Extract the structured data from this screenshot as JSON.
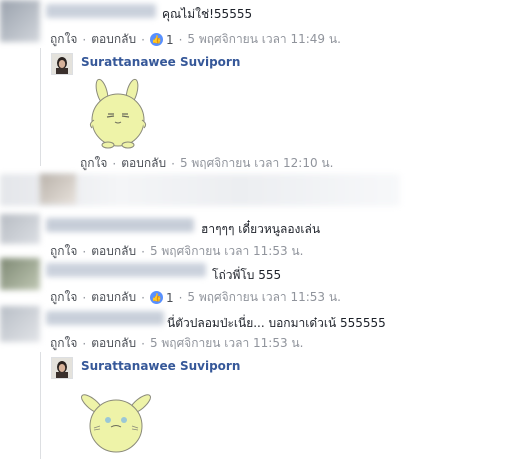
{
  "comments": [
    {
      "text": "คุณไม่ใช่!55555",
      "like": "ถูกใจ",
      "reply": "ตอบกลับ",
      "likes": "1",
      "time": "5 พฤศจิกายน เวลา 11:49 น."
    },
    {
      "text": "ฮาๆๆๆ เดี๋ยวหนูลองเล่น",
      "like": "ถูกใจ",
      "reply": "ตอบกลับ",
      "time": "5 พฤศจิกายน เวลา 11:53 น."
    },
    {
      "text": "โถ่วพี่โบ 555",
      "like": "ถูกใจ",
      "reply": "ตอบกลับ",
      "likes": "1",
      "time": "5 พฤศจิกายน เวลา 11:53 น."
    },
    {
      "text": "นี่ตัวปลอมป่ะเนี่ย... บอกมาเด๋วเน้ 555555",
      "like": "ถูกใจ",
      "reply": "ตอบกลับ",
      "time": "5 พฤศจิกายน เวลา 11:53 น."
    }
  ],
  "replies": [
    {
      "author": "Surattanawee Suviporn",
      "like": "ถูกใจ",
      "reply": "ตอบกลับ",
      "time": "5 พฤศจิกายน เวลา 12:10 น.",
      "sticker": "bunny-sticker"
    },
    {
      "author": "Surattanawee Suviporn",
      "sticker": "bunny-sticker"
    }
  ],
  "colors": {
    "link": "#365899",
    "meta": "#90949c",
    "like_blue": "#5890ff",
    "sticker_body": "#eef3a8"
  }
}
